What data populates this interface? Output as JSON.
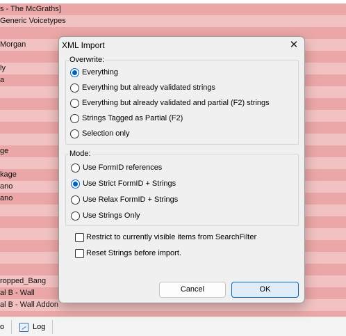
{
  "background_list": {
    "rows": [
      "s - The McGraths]",
      "Generic Voicetypes",
      "",
      "Morgan",
      "",
      "ly",
      "a",
      "",
      "",
      "",
      "",
      "",
      "ge",
      "",
      "kage",
      "ano",
      "ano",
      "",
      "",
      "",
      "",
      "",
      "",
      "ropped_Bang",
      "al B - Wall",
      "al B - Wall Addon",
      ""
    ]
  },
  "taskbar": {
    "left_fragment": "o",
    "log_label": "Log"
  },
  "dialog": {
    "title": "XML Import",
    "close_glyph": "✕",
    "overwrite": {
      "label": "Overwrite:",
      "options": [
        "Everything",
        "Everything but already validated strings",
        "Everything but already validated and partial (F2) strings",
        "Strings Tagged as Partial (F2)",
        "Selection only"
      ],
      "selected": "Everything"
    },
    "mode": {
      "label": "Mode:",
      "options": [
        "Use FormID references",
        "Use Strict FormID + Strings",
        "Use Relax FormID + Strings",
        "Use Strings Only"
      ],
      "selected": "Use Strict FormID + Strings"
    },
    "checkboxes": [
      {
        "label": "Restrict to currently visible items from SearchFilter",
        "checked": false
      },
      {
        "label": "Reset Strings before import.",
        "checked": false
      }
    ],
    "buttons": {
      "cancel": "Cancel",
      "ok": "OK"
    }
  },
  "colors": {
    "row_odd": "#eba7a7",
    "row_even": "#f2c2c2",
    "accent": "#0063c4",
    "dialog_bg": "#f0f0f0"
  }
}
